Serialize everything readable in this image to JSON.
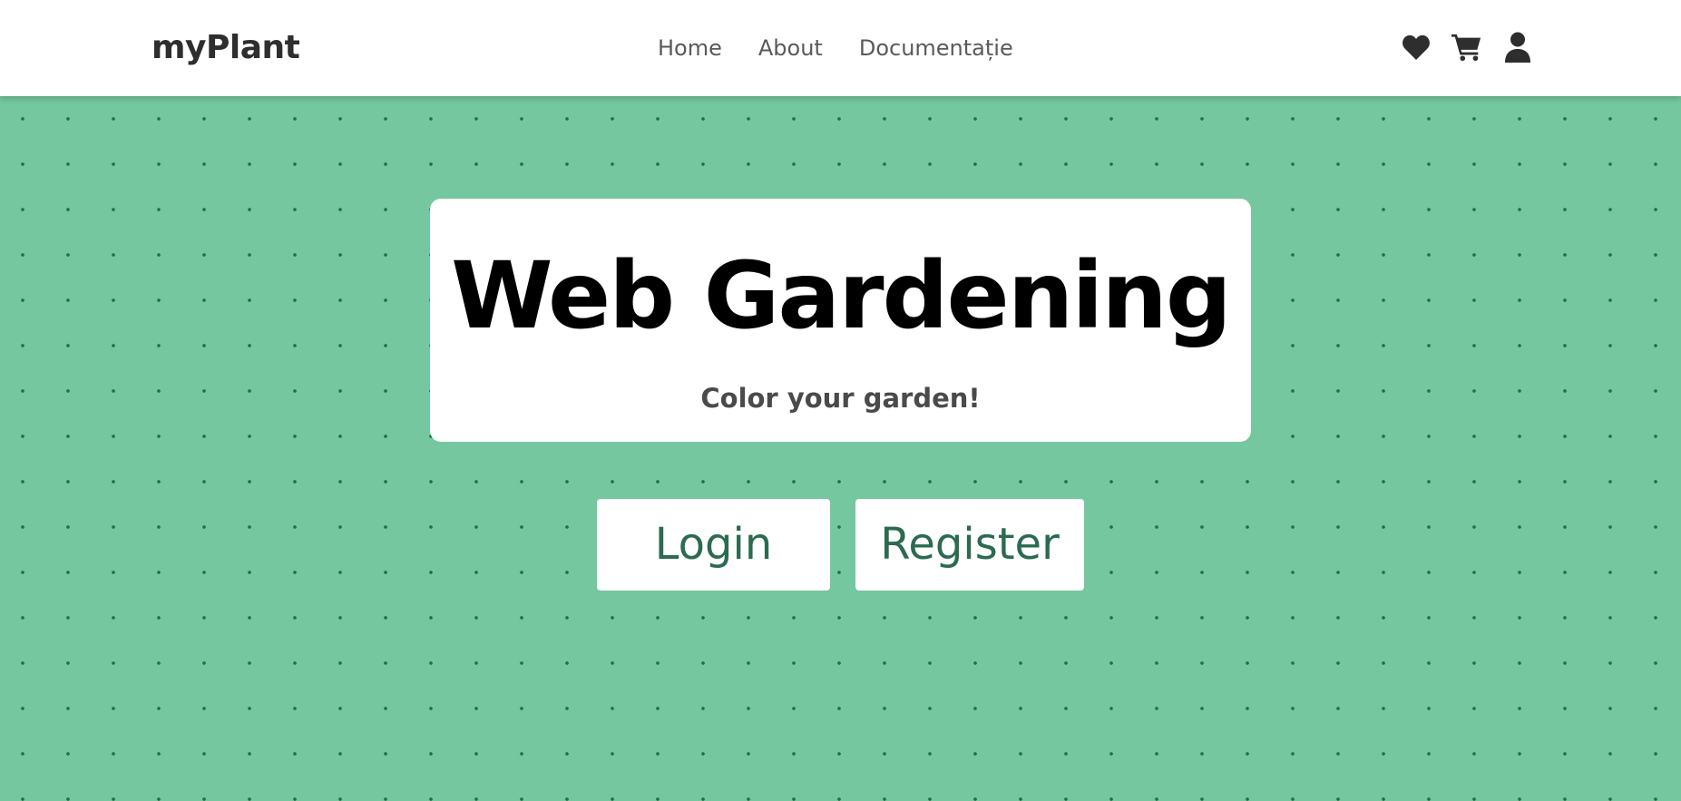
{
  "navbar": {
    "brand": "myPlant",
    "links": [
      {
        "label": "Home"
      },
      {
        "label": "About"
      },
      {
        "label": "Documentație"
      }
    ],
    "icons": [
      "heart-icon",
      "cart-icon",
      "user-icon"
    ]
  },
  "hero": {
    "title": "Web Gardening",
    "subtitle": "Color your garden!",
    "login_label": "Login",
    "register_label": "Register"
  },
  "colors": {
    "background": "#74c79e",
    "dot_pattern": "#2c6a4c",
    "button_text": "#2b6b4f",
    "nav_text": "#5a5a5a",
    "brand_text": "#2e2e2e"
  }
}
